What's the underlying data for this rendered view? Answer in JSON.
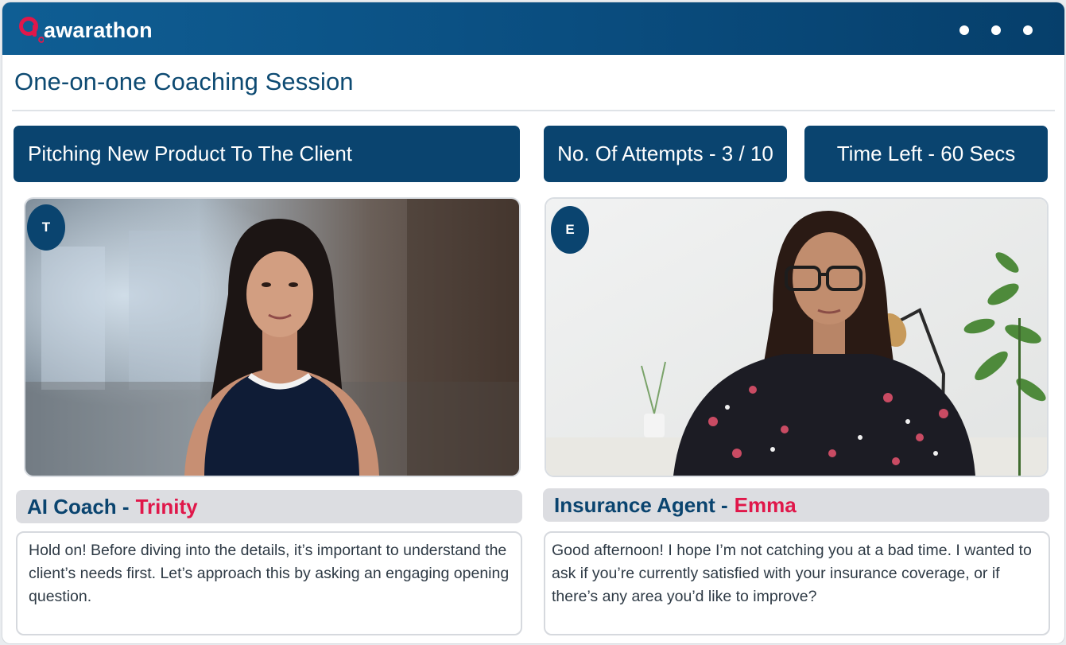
{
  "app": {
    "brand": "awarathon",
    "brand_color": "#e0174a",
    "header_color": "#0a446f",
    "menu_icon": "more-dots-icon"
  },
  "session": {
    "title": "One-on-one Coaching Session",
    "scenario": "Pitching New Product To The Client",
    "attempts_label": "No. Of Attempts - 3 / 10",
    "time_label": "Time Left - 60 Secs"
  },
  "coach": {
    "initial": "T",
    "role": "AI Coach",
    "separator": "-",
    "name": "Trinity",
    "message": "Hold on! Before diving into the details, it’s important to understand the client’s needs first. Let’s approach this by asking an engaging opening question."
  },
  "agent": {
    "initial": "E",
    "role": "Insurance Agent",
    "separator": "-",
    "name": "Emma",
    "message": " Good afternoon! I hope I’m not catching you at a bad time. I wanted to ask if you’re currently satisfied with your insurance coverage, or if there’s any area you’d like to improve?"
  }
}
